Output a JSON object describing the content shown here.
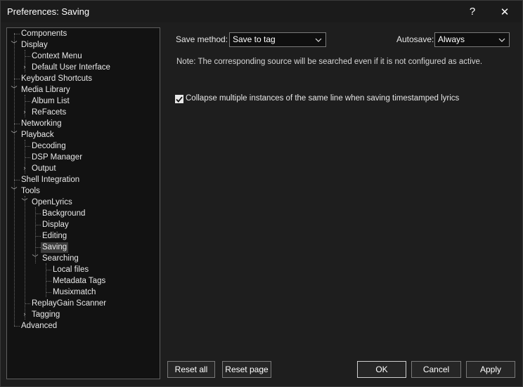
{
  "window": {
    "title": "Preferences: Saving",
    "help_glyph": "?",
    "close_glyph": "✕"
  },
  "tree": {
    "items": [
      {
        "label": "Components"
      },
      {
        "label": "Display"
      },
      {
        "label": "Context Menu"
      },
      {
        "label": "Default User Interface"
      },
      {
        "label": "Keyboard Shortcuts"
      },
      {
        "label": "Media Library"
      },
      {
        "label": "Album List"
      },
      {
        "label": "ReFacets"
      },
      {
        "label": "Networking"
      },
      {
        "label": "Playback"
      },
      {
        "label": "Decoding"
      },
      {
        "label": "DSP Manager"
      },
      {
        "label": "Output"
      },
      {
        "label": "Shell Integration"
      },
      {
        "label": "Tools"
      },
      {
        "label": "OpenLyrics"
      },
      {
        "label": "Background"
      },
      {
        "label": "Display"
      },
      {
        "label": "Editing"
      },
      {
        "label": "Saving",
        "selected": true
      },
      {
        "label": "Searching"
      },
      {
        "label": "Local files"
      },
      {
        "label": "Metadata Tags"
      },
      {
        "label": "Musixmatch"
      },
      {
        "label": "ReplayGain Scanner"
      },
      {
        "label": "Tagging"
      },
      {
        "label": "Advanced"
      }
    ]
  },
  "settings": {
    "save_method_label": "Save method:",
    "save_method_value": "Save to tag",
    "autosave_label": "Autosave:",
    "autosave_value": "Always",
    "note": "Note: The corresponding source will be searched even if it is not configured as active.",
    "collapse_checked": true,
    "collapse_label": "Collapse multiple instances of the same line when saving timestamped lyrics"
  },
  "buttons": {
    "reset_all": "Reset all",
    "reset_page": "Reset page",
    "ok": "OK",
    "cancel": "Cancel",
    "apply": "Apply"
  }
}
